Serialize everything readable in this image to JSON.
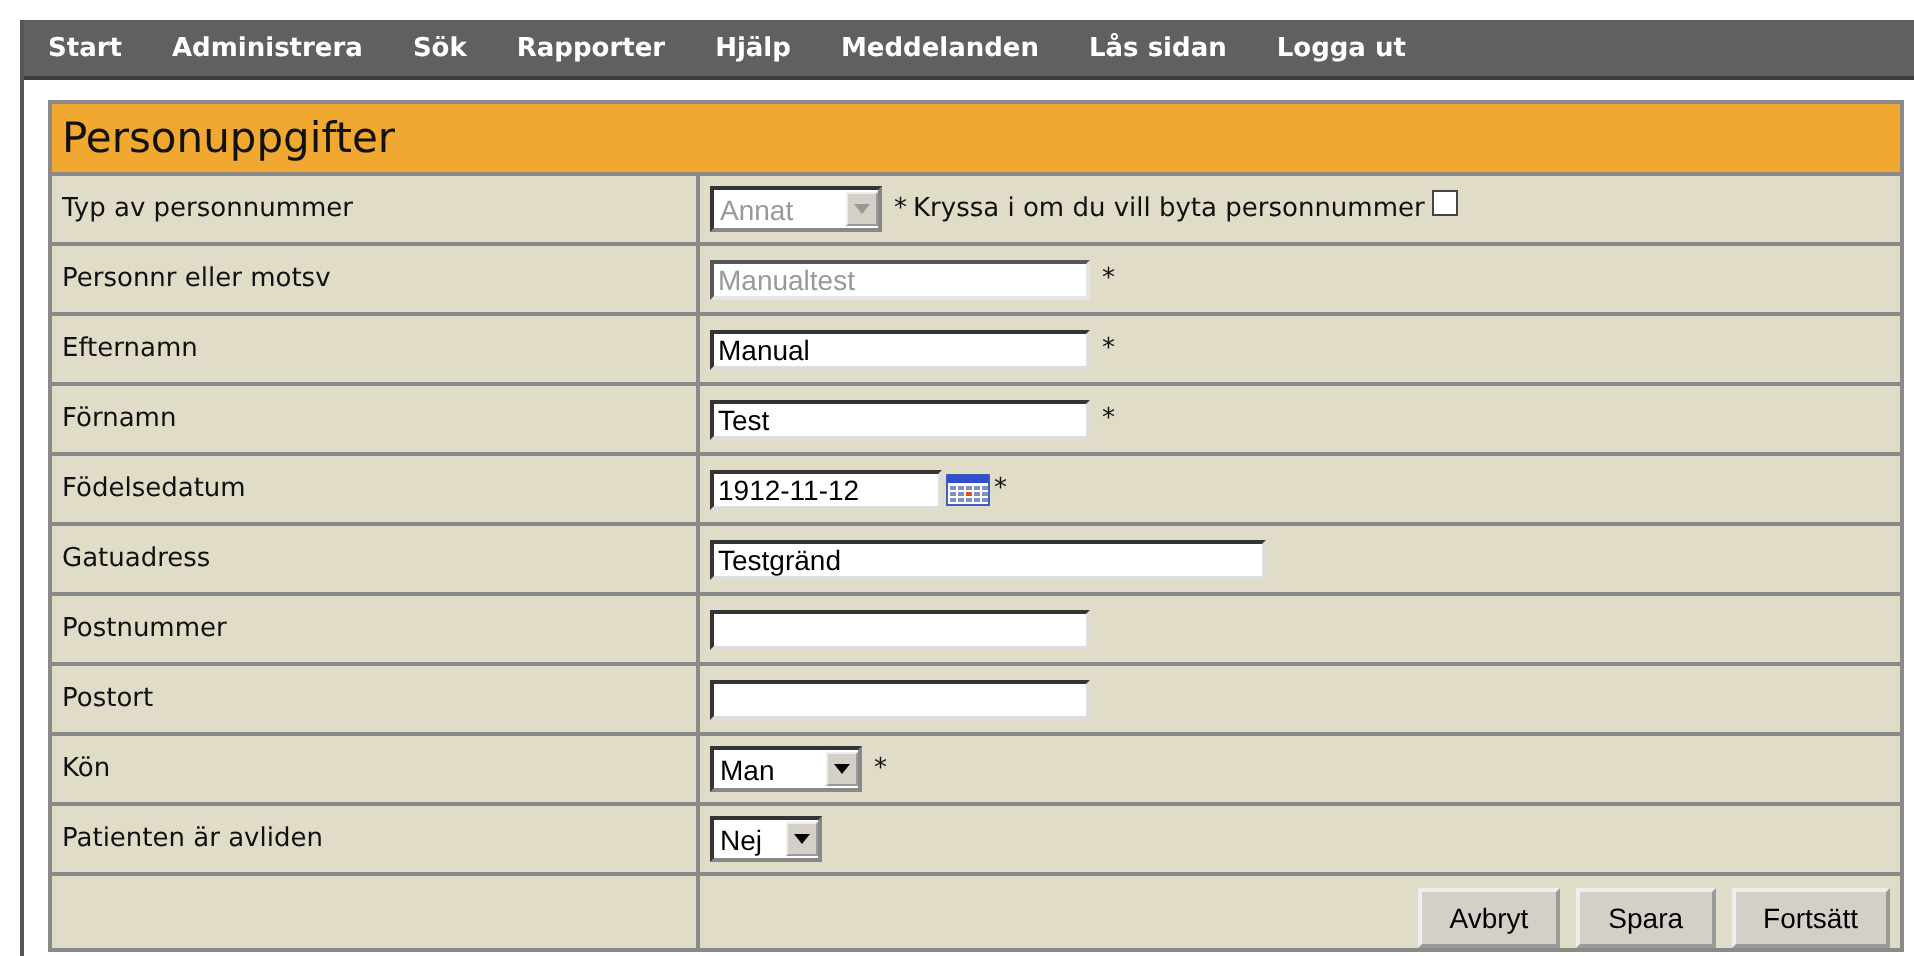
{
  "menu": [
    {
      "label": "Start"
    },
    {
      "label": "Administrera"
    },
    {
      "label": "Sök"
    },
    {
      "label": "Rapporter"
    },
    {
      "label": "Hjälp"
    },
    {
      "label": "Meddelanden"
    },
    {
      "label": "Lås sidan"
    },
    {
      "label": "Logga ut"
    }
  ],
  "form": {
    "title": "Personuppgifter",
    "rows": [
      {
        "label": "Typ av personnummer",
        "kind": "select",
        "value": "Annat",
        "disabled": true,
        "suffix": "*",
        "note": "Kryssa i om du vill byta personnummer",
        "checked": false
      },
      {
        "label": "Personnr eller motsv",
        "kind": "text",
        "value": "Manualtest",
        "disabled": true,
        "suffix": "*"
      },
      {
        "label": "Efternamn",
        "kind": "text",
        "value": "Manual",
        "disabled": false,
        "suffix": "*"
      },
      {
        "label": "Förnamn",
        "kind": "text",
        "value": "Test",
        "disabled": false,
        "suffix": "*"
      },
      {
        "label": "Födelsedatum",
        "kind": "date",
        "value": "1912-11-12",
        "disabled": false,
        "suffix": "*"
      },
      {
        "label": "Gatuadress",
        "kind": "longtext",
        "value": "Testgränd",
        "disabled": false
      },
      {
        "label": "Postnummer",
        "kind": "text",
        "value": "",
        "disabled": false
      },
      {
        "label": "Postort",
        "kind": "text",
        "value": "",
        "disabled": false
      },
      {
        "label": "Kön",
        "kind": "select",
        "value": "Man",
        "disabled": false,
        "suffix": "*"
      },
      {
        "label": "Patienten är avliden",
        "kind": "shortselect",
        "value": "Nej",
        "disabled": false
      }
    ],
    "buttons": [
      {
        "label": "Avbryt"
      },
      {
        "label": "Spara"
      },
      {
        "label": "Fortsätt"
      }
    ]
  }
}
